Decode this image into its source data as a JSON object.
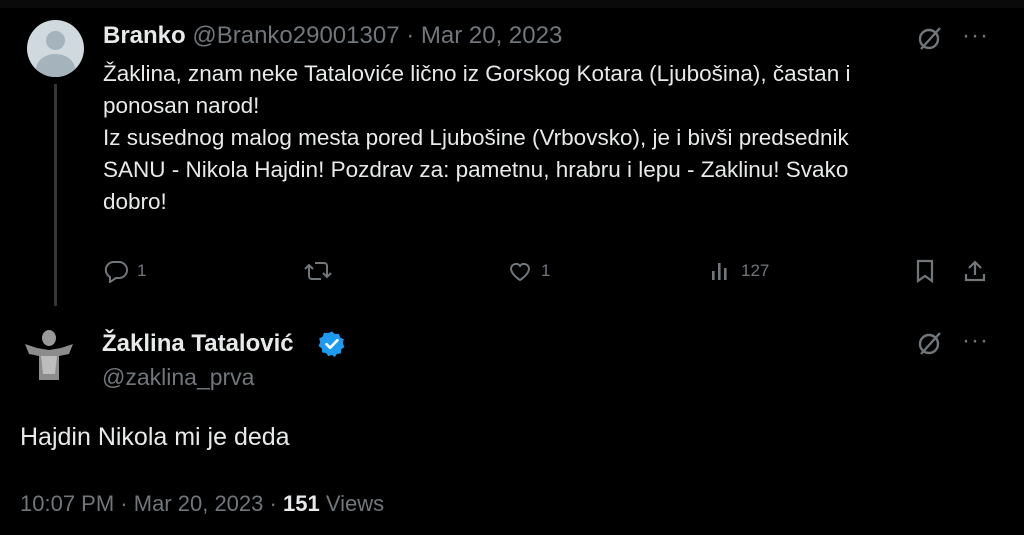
{
  "tweet": {
    "author_name": "Branko",
    "author_handle": "@Branko29001307",
    "separator": "·",
    "date": "Mar 20, 2023",
    "more": "···",
    "body": "Žaklina, znam neke Tataloviće lično iz Gorskog Kotara (Ljubošina), častan i\nponosan narod!\nIz susednog malog mesta pored Ljubošine (Vrbovsko), je i bivši predsednik\nSANU - Nikola Hajdin! Pozdrav za: pametnu, hrabru i lepu - Zaklinu! Svako\ndobro!",
    "actions": {
      "reply_count": "1",
      "retweet_count": "",
      "like_count": "1",
      "views_count": "127"
    }
  },
  "reply": {
    "author_name": "Žaklina Tatalović",
    "author_handle": "@zaklina_prva",
    "more": "···",
    "text": "Hajdin Nikola mi je deda",
    "time": "10:07 PM",
    "separator": "·",
    "date": "Mar 20, 2023",
    "views_count": "151",
    "views_label": "Views"
  },
  "colors": {
    "background": "#000000",
    "text": "#e7e9ea",
    "muted": "#71767b",
    "verified": "#1d9bf0"
  },
  "icons": [
    "reply-icon",
    "retweet-icon",
    "like-icon",
    "views-icon",
    "bookmark-icon",
    "share-icon",
    "grok-icon",
    "more-icon",
    "verified-icon"
  ]
}
